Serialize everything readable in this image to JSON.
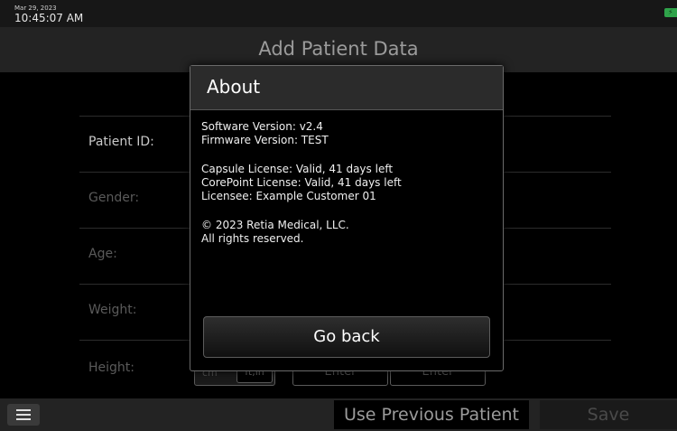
{
  "status": {
    "date": "Mar 29, 2023",
    "time": "10:45:07 AM",
    "battery_icon": "battery-plug-icon",
    "battery_color": "#2fa34a"
  },
  "header": {
    "title": "Add Patient Data"
  },
  "form": {
    "fields": [
      {
        "label": "Patient ID:"
      },
      {
        "label": "Gender:"
      },
      {
        "label": "Age:"
      },
      {
        "label": "Weight:"
      },
      {
        "label": "Height:"
      }
    ],
    "height_unit_selected": "ft,in",
    "enter_placeholder": "Enter"
  },
  "bottom_bar": {
    "menu_icon": "hamburger-menu-icon",
    "use_previous_label": "Use Previous Patient",
    "save_label": "Save"
  },
  "about_dialog": {
    "title": "About",
    "software_version": "Software Version: v2.4",
    "firmware_version": "Firmware Version: TEST",
    "capsule_license": "Capsule License: Valid, 41 days left",
    "corepoint_license": "CorePoint License: Valid, 41 days left",
    "licensee": "Licensee: Example Customer 01",
    "copyright": "© 2023 Retia Medical, LLC.",
    "rights": "All rights reserved.",
    "go_back_label": "Go back"
  }
}
